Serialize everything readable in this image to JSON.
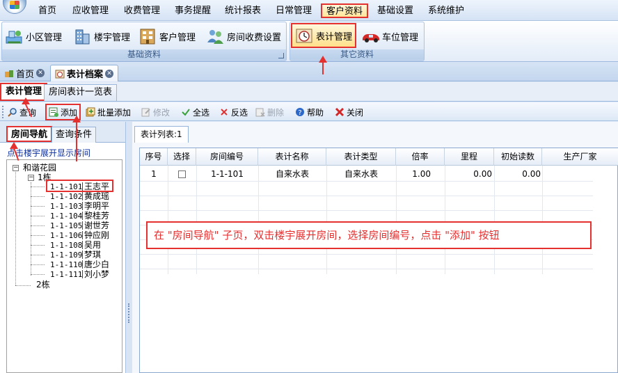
{
  "menu": {
    "items": [
      "首页",
      "应收管理",
      "收费管理",
      "事务提醒",
      "统计报表",
      "日常管理",
      "客户资料",
      "基础设置",
      "系统维护"
    ],
    "active_index": 6
  },
  "ribbon": {
    "group_basic": {
      "caption": "基础资料",
      "buttons": [
        "小区管理",
        "楼宇管理",
        "客户管理",
        "房间收费设置"
      ]
    },
    "group_other": {
      "caption": "其它资料",
      "buttons": [
        "表计管理",
        "车位管理"
      ]
    }
  },
  "doc_tabs": {
    "home": "首页",
    "meter_archive": "表计档案"
  },
  "sub_tabs": {
    "meter_manage": "表计管理",
    "room_meter_list": "房间表计一览表"
  },
  "toolbar": {
    "query": "查询",
    "add": "添加",
    "batch_add": "批量添加",
    "edit": "修改",
    "select_all": "全选",
    "invert": "反选",
    "delete": "删除",
    "help": "帮助",
    "close": "关闭"
  },
  "left_panel": {
    "tab_room_nav": "房间导航",
    "tab_query": "查询条件",
    "hint": "点击楼宇展开显示房间",
    "tree": {
      "root": "和谐花园",
      "building_1": "1栋",
      "building_2": "2栋",
      "rooms": [
        {
          "code": "1-1-101",
          "name": "王志平"
        },
        {
          "code": "1-1-102",
          "name": "黄成瑶"
        },
        {
          "code": "1-1-103",
          "name": "李明平"
        },
        {
          "code": "1-1-104",
          "name": "黎桂芳"
        },
        {
          "code": "1-1-105",
          "name": "谢世芳"
        },
        {
          "code": "1-1-106",
          "name": "钟应刚"
        },
        {
          "code": "1-1-108",
          "name": "吴用"
        },
        {
          "code": "1-1-109",
          "name": "梦琪"
        },
        {
          "code": "1-1-110",
          "name": "唐少白"
        },
        {
          "code": "1-1-111",
          "name": "刘小梦"
        }
      ]
    }
  },
  "grid": {
    "tab_label": "表计列表:1",
    "columns": [
      "序号",
      "选择",
      "房间编号",
      "表计名称",
      "表计类型",
      "倍率",
      "里程",
      "初始读数",
      "生产厂家"
    ],
    "rows": [
      {
        "no": "1",
        "room": "1-1-101",
        "meter_name": "自来水表",
        "meter_type": "自来水表",
        "rate": "1.00",
        "mileage": "0.00",
        "initial": "0.00",
        "maker": ""
      }
    ]
  },
  "annotation": "在 \"房间导航\" 子页，双击楼宇展开房间，选择房间编号，点击 \"添加\" 按钮",
  "colors": {
    "highlight_red": "#e53030",
    "ribbon_blue": "#dbe7f6",
    "link_blue": "#0b2f9e"
  }
}
